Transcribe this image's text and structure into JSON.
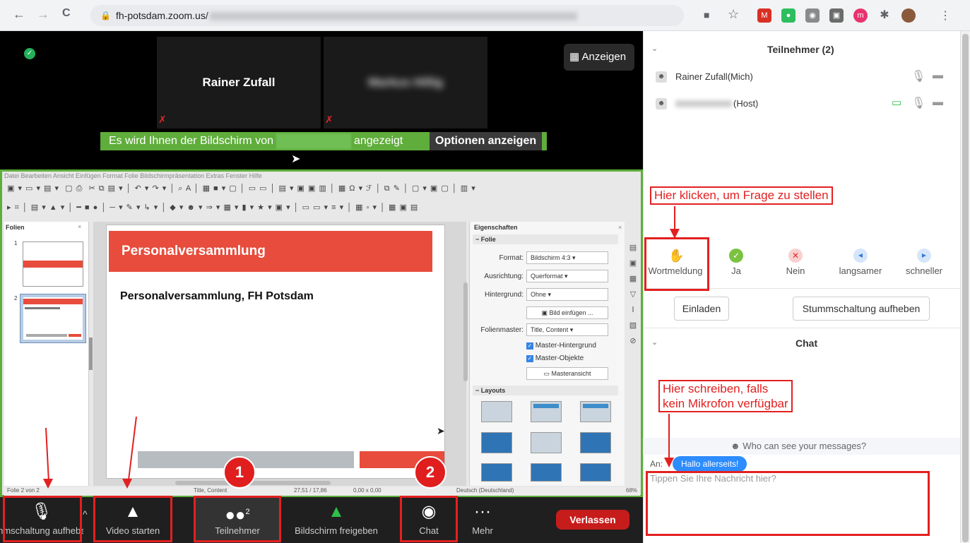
{
  "browser": {
    "url_host": "fh-potsdam.zoom.us/",
    "back": "←",
    "forward": "→",
    "reload": "C"
  },
  "meeting": {
    "show_button": "Anzeigen",
    "tile1_name": "Rainer Zufall",
    "tile2_name": "Markus Hillig",
    "banner_pre": "Es wird Ihnen der Bildschirm von",
    "banner_post": "angezeigt",
    "options_button": "Optionen anzeigen"
  },
  "office": {
    "menu": "Datei   Bearbeiten   Ansicht   Einfügen   Format   Folie   Bildschirmpräsentation   Extras   Fenster   Hilfe",
    "slides_panel_title": "Folien",
    "slide1_num": "1",
    "slide2_num": "2",
    "slide_title": "Personalversammlung",
    "slide_subtitle": "Personalversammlung, FH Potsdam",
    "props_title": "Eigenschaften",
    "section_folie": "Folie",
    "format_label": "Format:",
    "format_value": "Bildschirm 4:3",
    "orient_label": "Ausrichtung:",
    "orient_value": "Querformat",
    "bg_label": "Hintergrund:",
    "bg_value": "Ohne",
    "insert_image": "Bild einfügen ...",
    "master_label": "Folienmaster:",
    "master_value": "Title, Content",
    "master_bg": "Master-Hintergrund",
    "master_obj": "Master-Objekte",
    "master_view": "Masteransicht",
    "layouts": "Layouts",
    "status_slide": "Folie 2 von 2",
    "status_layout": "Title, Content",
    "status_pos": "27,51 / 17,86",
    "status_size": "0,00 x 0,00",
    "status_lang": "Deutsch (Deutschland)",
    "status_zoom": "68%"
  },
  "toolbar": {
    "mute": "Stummschaltung aufheben",
    "video": "Video starten",
    "participants": "Teilnehmer",
    "participants_count": "2",
    "share": "Bildschirm freigeben",
    "chat": "Chat",
    "more": "Mehr",
    "leave": "Verlassen"
  },
  "participants": {
    "title": "Teilnehmer (2)",
    "p1": "Rainer Zufall(Mich)",
    "p2_suffix": "(Host)",
    "reactions": [
      "Wortmeldung",
      "Ja",
      "Nein",
      "langsamer",
      "schneller"
    ],
    "invite": "Einladen",
    "unmute_all": "Stummschaltung aufheben"
  },
  "chat": {
    "title": "Chat",
    "who_can_see": "Who can see your messages?",
    "to_label": "An:",
    "to_value": "Hallo allerseits!",
    "placeholder": "Tippen Sie Ihre Nachricht hier?"
  },
  "annotations": {
    "raise_hand_hint": "Hier klicken, um Frage zu stellen",
    "chat_hint_line1": "Hier schreiben, falls",
    "chat_hint_line2": "kein Mikrofon verfügbar",
    "badge1": "1",
    "badge2": "2"
  },
  "colors": {
    "green": "#5fad3b",
    "red": "#e32020",
    "slide_red": "#e74c3c",
    "leave_red": "#c71c1c"
  }
}
